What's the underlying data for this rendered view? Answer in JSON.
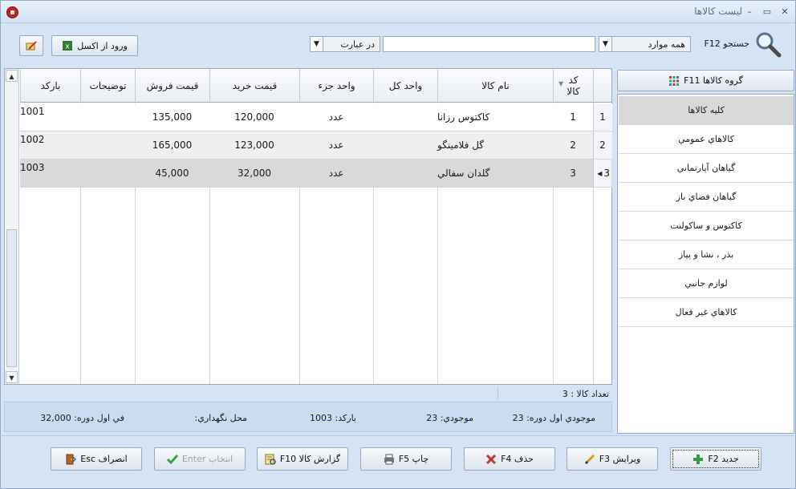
{
  "window": {
    "title": "ليست کالاها",
    "min": "–",
    "max": "▭",
    "close": "✕"
  },
  "toolbar": {
    "search_label": "جستجو F12",
    "scope": "همه موارد",
    "match": "در عبارت",
    "search_value": "",
    "excel_label": "ورود از اکسل"
  },
  "grid": {
    "headers": [
      "کد کالا",
      "نام کالا",
      "واحد کل",
      "واحد جزء",
      "قيمت خريد",
      "قيمت فروش",
      "توضيحات",
      "بارکد"
    ],
    "rows": [
      {
        "num": "1",
        "code": "1",
        "name": "کاکتوس رزانا",
        "unit_all": "",
        "unit_part": "عدد",
        "buy": "120,000",
        "sell": "135,000",
        "desc": "",
        "barcode": "1001"
      },
      {
        "num": "2",
        "code": "2",
        "name": "گل فلامينگو",
        "unit_all": "",
        "unit_part": "عدد",
        "buy": "123,000",
        "sell": "165,000",
        "desc": "",
        "barcode": "1002"
      },
      {
        "num": "3",
        "code": "3",
        "name": "گلدان سفالي",
        "unit_all": "",
        "unit_part": "عدد",
        "buy": "32,000",
        "sell": "45,000",
        "desc": "",
        "barcode": "1003"
      }
    ]
  },
  "groups": {
    "button_label": "گروه کالاها F11",
    "items": [
      "کليه کالاها",
      "کالاهاي عمومي",
      "گياهان آپارتماني",
      "گياهان فضاي باز",
      "کاکتوس و ساکولنت",
      "بذر ، نشا و پياز",
      "لوازم جانبي",
      "کالاهاي غير فعال"
    ]
  },
  "status": {
    "count": "تعداد کالا : 3",
    "opening_stock": "موجودي اول دوره: 23",
    "stock": "موجودي: 23",
    "barcode": "بارکد: 1003",
    "location": "محل نگهداري:",
    "opening_price": "في اول دوره: 32,000"
  },
  "actions": {
    "new": "جديد F2",
    "edit": "ويرايش F3",
    "delete": "حذف F4",
    "print": "چاپ F5",
    "report": "گزارش کالا F10",
    "select": "انتخاب Enter",
    "cancel": "انصراف Esc"
  }
}
